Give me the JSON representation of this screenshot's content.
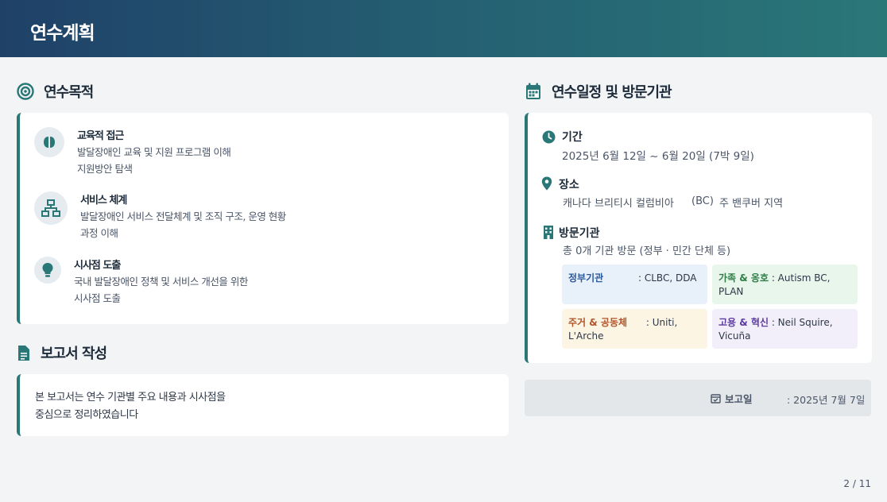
{
  "header": {
    "title": "연수계획"
  },
  "objectives": {
    "heading": "연수목적",
    "items": [
      {
        "title": "교육적 접근",
        "desc_line1": "발달장애인 교육 및 지원 프로그램 이해",
        "desc_line2": "지원방안 탐색"
      },
      {
        "title": "서비스 체계",
        "desc_line1": "발달장애인 서비스 전달체계 및 조직 구조, 운영 현황",
        "desc_line2": "과정 이해"
      },
      {
        "title": "시사점 도출",
        "desc_line1": "국내 발달장애인 정책 및 서비스 개선을 위한",
        "desc_line2": "시사점 도출"
      }
    ]
  },
  "notes": {
    "heading": "보고서 작성",
    "line1": "본 보고서는 연수 기관별 주요 내용과 시사점을",
    "line2": "중심으로 정리하였습니다"
  },
  "overview": {
    "heading": "연수일정 및 방문기관",
    "period": {
      "label": "기간",
      "value": "2025년 6월 12일 ~ 6월 20일 (7박 9일)"
    },
    "location": {
      "label": "장소",
      "value_left": "캐나다 브리티시 컬럼비아",
      "value_mid": "(BC)",
      "value_right": "주 밴쿠버 지역"
    },
    "institutions": {
      "label": "방문기관",
      "summary": "총 0개 기관 방문 (정부 · 민간 단체 등)",
      "orgs": [
        {
          "category": "정부기관",
          "list": ": CLBC, DDA"
        },
        {
          "category": "가족 & 옹호",
          "list": ": Autism BC, PLAN"
        },
        {
          "category": "주거 & 공동체",
          "list": ": Uniti, L'Arche"
        },
        {
          "category": "고용 & 혁신",
          "list": ": Neil Squire, Vicuña"
        }
      ]
    }
  },
  "footer": {
    "label": "보고일",
    "date": ": 2025년 7월 7일"
  },
  "page": {
    "number": "2 / 11"
  },
  "colors": {
    "accent": "#2a7778",
    "header_start": "#1f4168",
    "header_end": "#2a7778"
  }
}
